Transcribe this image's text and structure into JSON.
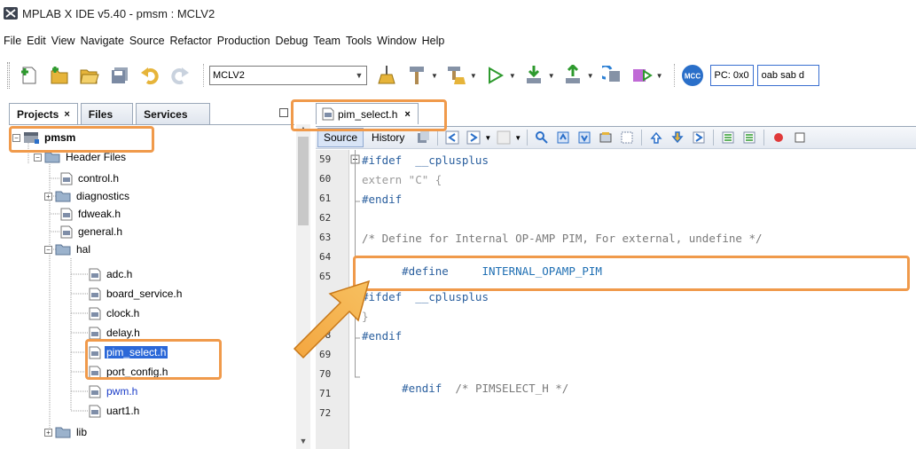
{
  "window": {
    "title": "MPLAB X IDE v5.40 - pmsm : MCLV2"
  },
  "menu": [
    "File",
    "Edit",
    "View",
    "Navigate",
    "Source",
    "Refactor",
    "Production",
    "Debug",
    "Team",
    "Tools",
    "Window",
    "Help"
  ],
  "toolbar": {
    "config_value": "MCLV2",
    "mcc_label": "MCC",
    "pc_label": "PC: 0x0",
    "status_text": "oab sab d"
  },
  "projects_panel": {
    "tabs": [
      {
        "label": "Projects",
        "close": "×"
      },
      {
        "label": "Files"
      },
      {
        "label": "Services"
      }
    ],
    "tree": {
      "project": "pmsm",
      "header_files": "Header Files",
      "items": [
        "control.h",
        "diagnostics",
        "fdweak.h",
        "general.h",
        "hal"
      ],
      "hal_items": [
        "adc.h",
        "board_service.h",
        "clock.h",
        "delay.h",
        "pim_select.h",
        "port_config.h",
        "pwm.h",
        "uart1.h"
      ],
      "lib": "lib"
    }
  },
  "editor": {
    "tab_label": "pim_select.h",
    "tab_close": "×",
    "modes": [
      "Source",
      "History"
    ],
    "lines": [
      {
        "no": "59",
        "text": "#ifdef  __cplusplus"
      },
      {
        "no": "60",
        "text": "extern \"C\" {"
      },
      {
        "no": "61",
        "text": "#endif"
      },
      {
        "no": "62",
        "text": ""
      },
      {
        "no": "63",
        "text": "/* Define for Internal OP-AMP PIM, For external, undefine */"
      },
      {
        "no": "64",
        "kw": "#define",
        "ident": "INTERNAL_OPAMP_PIM"
      },
      {
        "no": "65",
        "text": ""
      },
      {
        "no": "66",
        "text": "#ifdef  __cplusplus"
      },
      {
        "no": "67",
        "text": "}"
      },
      {
        "no": "68",
        "text": "#endif"
      },
      {
        "no": "69",
        "text": ""
      },
      {
        "no": "70",
        "kw": "#endif",
        "comment": "/* PIMSELECT_H */"
      },
      {
        "no": "71",
        "text": ""
      },
      {
        "no": "72",
        "text": ""
      }
    ]
  },
  "colors": {
    "highlight": "#f09a4b",
    "selection": "#2b68d8",
    "keyword": "#2a5f9e"
  }
}
